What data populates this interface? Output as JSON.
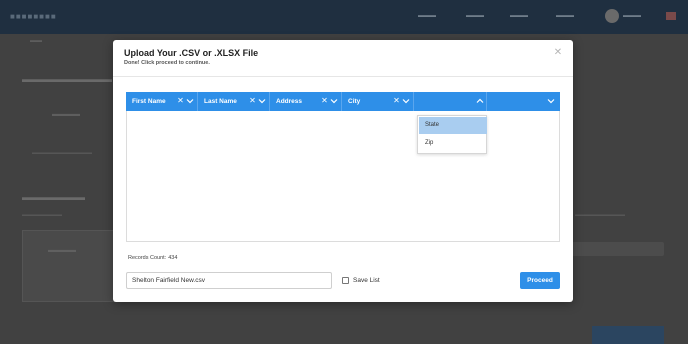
{
  "modal": {
    "title": "Upload Your .CSV or .XLSX File",
    "subtitle": "Done! Click proceed to continue.",
    "close_icon": "close-icon"
  },
  "table": {
    "columns": [
      {
        "label": "First Name",
        "has_clear": true,
        "chevron": "down"
      },
      {
        "label": "Last Name",
        "has_clear": true,
        "chevron": "down"
      },
      {
        "label": "Address",
        "has_clear": true,
        "chevron": "down"
      },
      {
        "label": "City",
        "has_clear": true,
        "chevron": "down"
      },
      {
        "label": "",
        "has_clear": false,
        "chevron": "up"
      },
      {
        "label": "",
        "has_clear": false,
        "chevron": "down"
      }
    ],
    "open_dropdown": {
      "options": [
        "State",
        "Zip"
      ],
      "highlighted": "State"
    }
  },
  "footer": {
    "records_label": "Records Count:",
    "records_count": "434",
    "file_name": "Shelton Fairfield New.csv",
    "save_list_label": "Save List",
    "save_list_checked": false,
    "proceed_label": "Proceed"
  },
  "colors": {
    "accent": "#2e8fe8",
    "highlight": "#a9cdf0",
    "overlay": "#3a3a3a"
  }
}
